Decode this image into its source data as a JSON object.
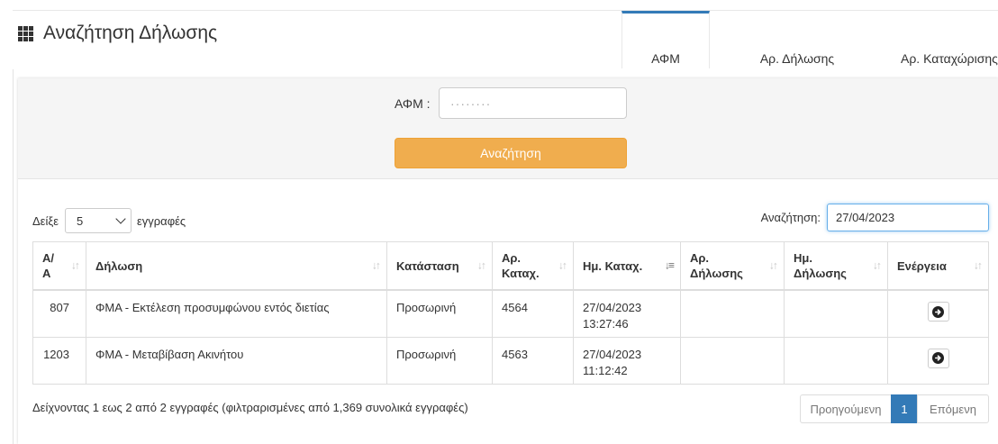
{
  "header": {
    "title": "Αναζήτηση Δήλωσης"
  },
  "tabs": [
    {
      "label": "ΑΦΜ",
      "active": true
    },
    {
      "label": "Αρ. Δήλωσης",
      "active": false
    },
    {
      "label": "Αρ. Καταχώρισης",
      "active": false
    }
  ],
  "search": {
    "afm_label": "ΑΦΜ :",
    "afm_value": "········",
    "button_label": "Αναζήτηση"
  },
  "table_controls": {
    "show_label": "Δείξε",
    "page_length": "5",
    "records_label": "εγγραφές",
    "filter_label": "Αναζήτηση:",
    "filter_value": "27/04/2023"
  },
  "table": {
    "columns": [
      {
        "label": "Α/\nΑ"
      },
      {
        "label": "Δήλωση"
      },
      {
        "label": "Κατάσταση"
      },
      {
        "label": "Αρ.\nΚαταχ."
      },
      {
        "label": "Ημ. Καταχ."
      },
      {
        "label": "Αρ.\nΔήλωσης"
      },
      {
        "label": "Ημ.\nΔήλωσης"
      },
      {
        "label": "Ενέργεια"
      }
    ],
    "rows": [
      {
        "aa": "807",
        "declaration": "ΦΜΑ - Εκτέλεση προσυμφώνου εντός διετίας",
        "status": "Προσωρινή",
        "reg_no": "4564",
        "reg_date": "27/04/2023\n13:27:46",
        "decl_no": "",
        "decl_date": ""
      },
      {
        "aa": "1203",
        "declaration": "ΦΜΑ - Μεταβίβαση Ακινήτου",
        "status": "Προσωρινή",
        "reg_no": "4563",
        "reg_date": "27/04/2023\n11:12:42",
        "decl_no": "",
        "decl_date": ""
      }
    ]
  },
  "footer": {
    "info": "Δείχνοντας 1 εως 2 από 2 εγγραφές (φιλτραρισμένες από 1,369 συνολικά εγγραφές)",
    "prev_label": "Προηγούμενη",
    "current_page": "1",
    "next_label": "Επόμενη"
  },
  "icons": {
    "title_icon": "grid-icon",
    "action_icon": "arrow-circle-right-icon",
    "sort_icon": "sort-arrows-icon"
  },
  "colors": {
    "primary": "#337ab7",
    "search_button": "#f0ad4e"
  }
}
